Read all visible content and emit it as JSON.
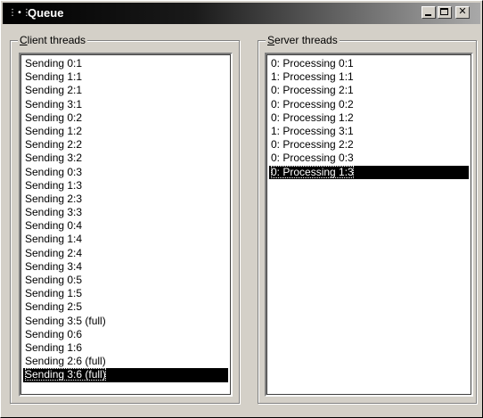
{
  "window": {
    "title": "Queue",
    "controls": {
      "minimize": "minimize",
      "maximize": "maximize",
      "close": "close"
    }
  },
  "client": {
    "label_accel": "C",
    "label_rest": "lient threads",
    "items": [
      "Sending 0:1",
      "Sending 1:1",
      "Sending 2:1",
      "Sending 3:1",
      "Sending 0:2",
      "Sending 1:2",
      "Sending 2:2",
      "Sending 3:2",
      "Sending 0:3",
      "Sending 1:3",
      "Sending 2:3",
      "Sending 3:3",
      "Sending 0:4",
      "Sending 1:4",
      "Sending 2:4",
      "Sending 3:4",
      "Sending 0:5",
      "Sending 1:5",
      "Sending 2:5",
      "Sending 3:5 (full)",
      "Sending 0:6",
      "Sending 1:6",
      "Sending 2:6 (full)",
      "Sending 3:6 (full)"
    ],
    "selected_index": 23
  },
  "server": {
    "label_accel": "S",
    "label_rest": "erver threads",
    "items": [
      "0: Processing 0:1",
      "1: Processing 1:1",
      "0: Processing 2:1",
      "0: Processing 0:2",
      "0: Processing 1:2",
      "1: Processing 3:1",
      "0: Processing 2:2",
      "0: Processing 0:3",
      "0: Processing 1:3"
    ],
    "selected_index": 8
  },
  "icons": {
    "app": "queue-app-icon",
    "minimize": "minimize-icon",
    "maximize": "maximize-icon",
    "close": "close-icon"
  }
}
